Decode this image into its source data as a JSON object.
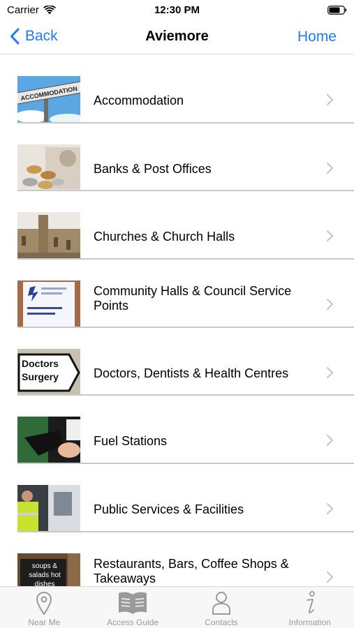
{
  "status": {
    "carrier": "Carrier",
    "time": "12:30 PM"
  },
  "nav": {
    "back_label": "Back",
    "title": "Aviemore",
    "home_label": "Home"
  },
  "categories": [
    {
      "label": "Accommodation",
      "thumb_text": "ACCOMMODATION"
    },
    {
      "label": "Banks & Post Offices"
    },
    {
      "label": "Churches & Church Halls"
    },
    {
      "label": "Community Halls & Council Service Points"
    },
    {
      "label": "Doctors, Dentists & Health Centres",
      "thumb_text": "Doctors Surgery"
    },
    {
      "label": "Fuel Stations"
    },
    {
      "label": "Public Services & Facilities"
    },
    {
      "label": "Restaurants, Bars, Coffee Shops & Takeaways",
      "thumb_text": "soups & salads hot dishes"
    }
  ],
  "tabs": [
    {
      "label": "Near Me",
      "icon": "location-pin-icon"
    },
    {
      "label": "Access Guide",
      "icon": "book-icon"
    },
    {
      "label": "Contacts",
      "icon": "person-icon"
    },
    {
      "label": "Information",
      "icon": "info-icon"
    }
  ],
  "colors": {
    "accent": "#1e7cf3",
    "tab_inactive": "#9a9a9a",
    "separator": "#c8c8c8"
  }
}
